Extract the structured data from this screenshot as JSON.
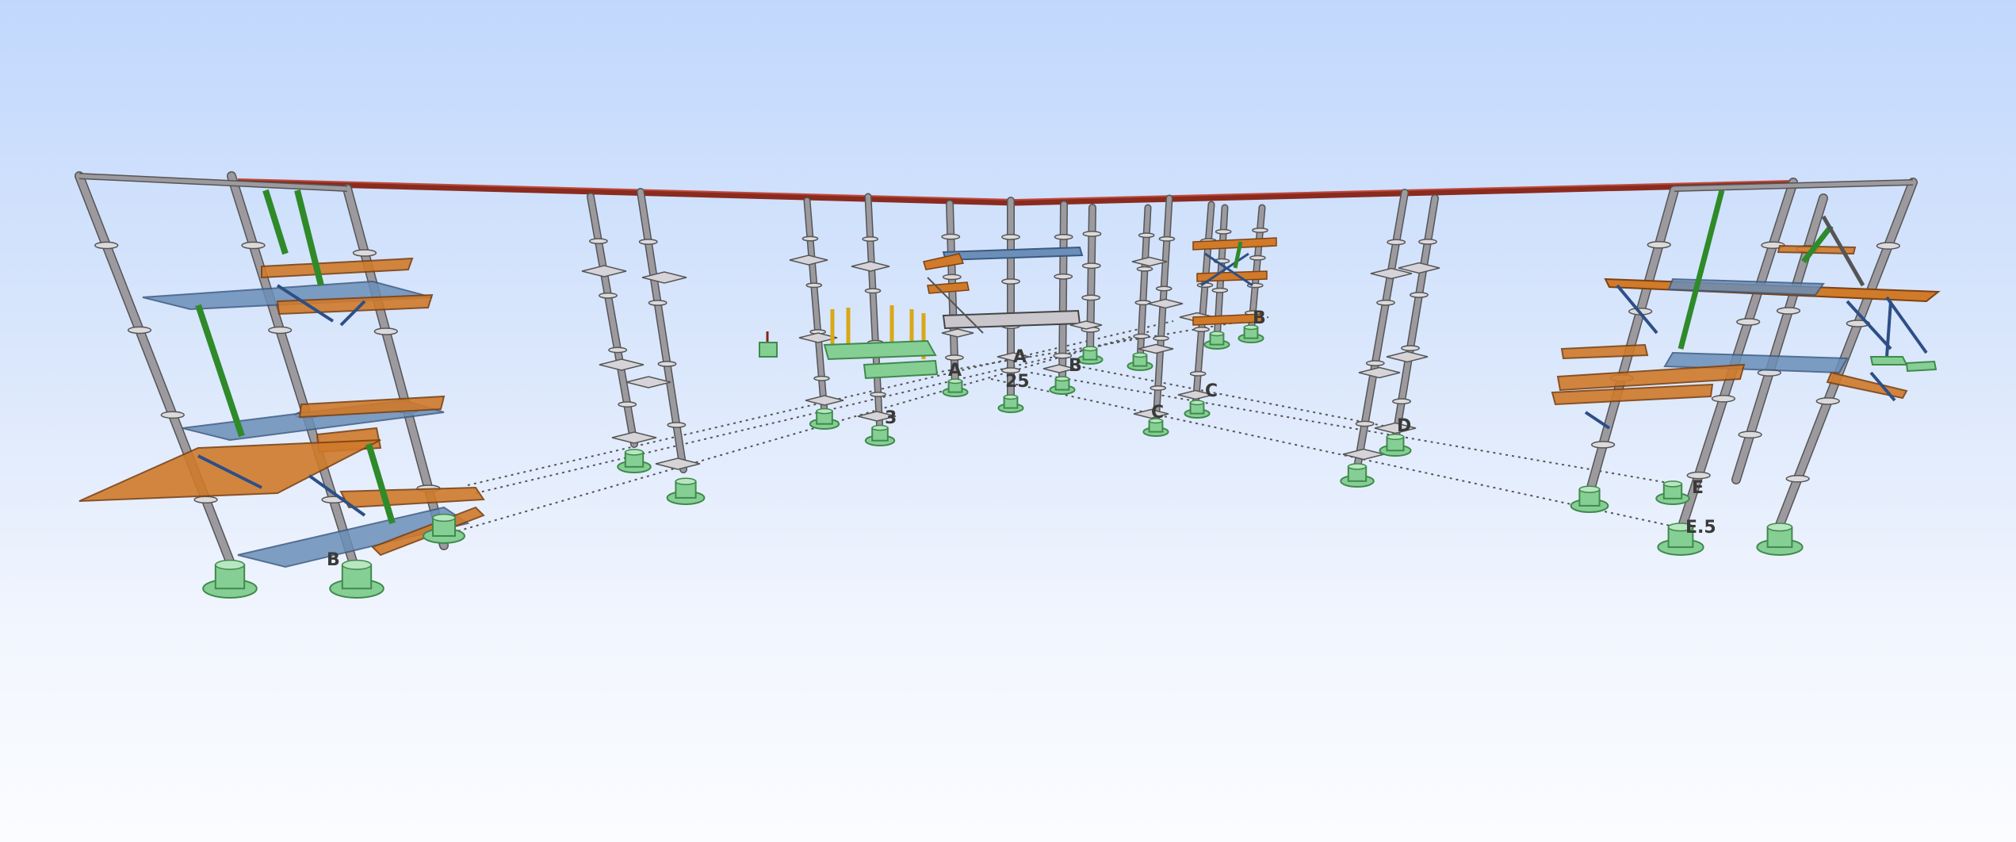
{
  "viewport": {
    "background_top": "#c1d8fd",
    "background_bottom": "#fbfcff"
  },
  "colors": {
    "column": "#9c9a9e",
    "column_edge": "#555555",
    "footing": "#86cf94",
    "footing_edge": "#3f8a4c",
    "top_beam": "#8a2b1f",
    "orange_member": "#d07a2a",
    "blue_deck": "#6b8fb8",
    "green_brace": "#2f8a2a",
    "navy_brace": "#2d4f86",
    "gridline": "#555555"
  },
  "grid_labels": {
    "b_left": "B",
    "a_center_left": "A",
    "a_center": "A",
    "num_25": "25",
    "num_3": "3",
    "b_center": "B",
    "c_center": "C",
    "c_right": "C",
    "b_right": "B",
    "d_right": "D",
    "e5": "E.5",
    "e_right": "E"
  }
}
